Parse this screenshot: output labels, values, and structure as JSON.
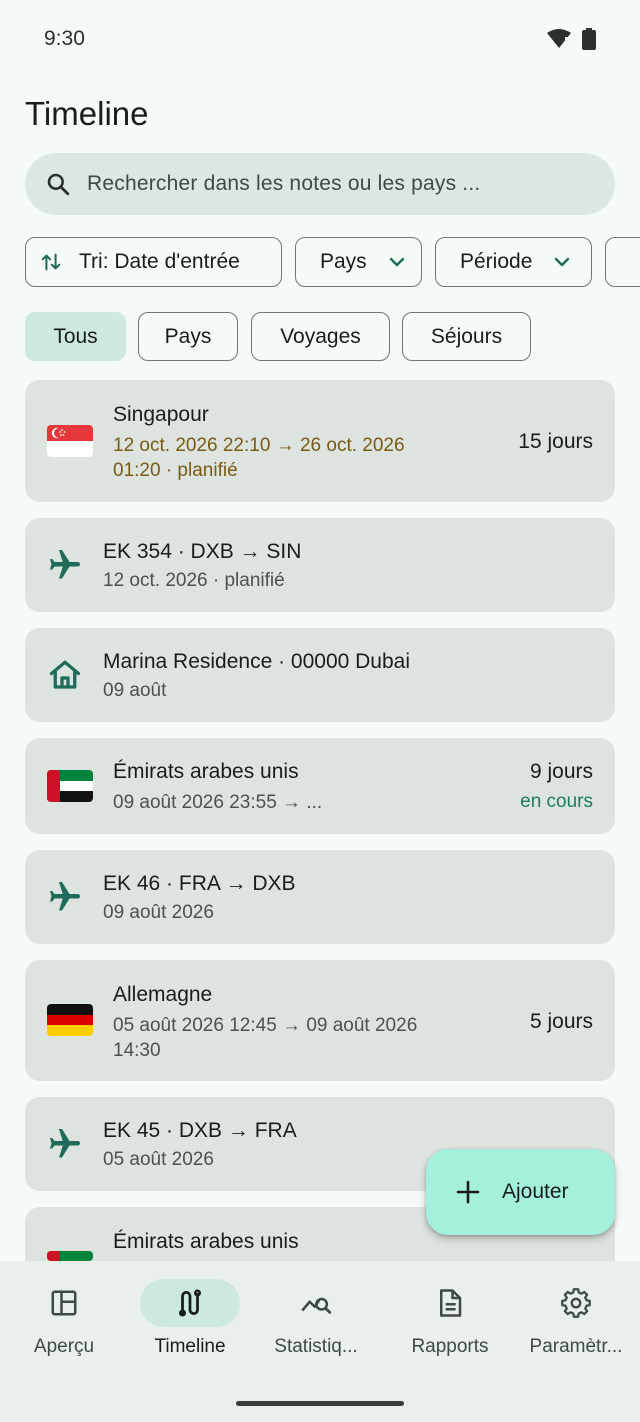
{
  "status": {
    "time": "9:30"
  },
  "page": {
    "title": "Timeline"
  },
  "search": {
    "placeholder": "Rechercher dans les notes ou les pays ..."
  },
  "filters": {
    "sort": "Tri: Date d'entrée",
    "country": "Pays",
    "period": "Période"
  },
  "segments": [
    "Tous",
    "Pays",
    "Voyages",
    "Séjours"
  ],
  "timeline": {
    "items": [
      {
        "kind": "country",
        "flag": "singapore",
        "title": "Singapour",
        "line1": "12 oct. 2026 22:10  →  26 oct. 2026",
        "line2": "01:20 · planifié",
        "days": "15 jours"
      },
      {
        "kind": "flight",
        "title": "EK 354 · DXB → SIN",
        "subtitle": "12 oct. 2026 · planifié"
      },
      {
        "kind": "stay",
        "title": "Marina Residence · 00000 Dubai",
        "subtitle": "09 août"
      },
      {
        "kind": "country",
        "flag": "uae",
        "title": "Émirats arabes unis",
        "line1": "09 août 2026 23:55  →  ...",
        "days": "9 jours",
        "status": "en cours"
      },
      {
        "kind": "flight",
        "title": "EK 46 · FRA → DXB",
        "subtitle": "09 août 2026"
      },
      {
        "kind": "country",
        "flag": "germany",
        "title": "Allemagne",
        "line1": "05 août 2026 12:45  →  09 août 2026",
        "line2": "14:30",
        "days": "5 jours"
      },
      {
        "kind": "flight",
        "title": "EK 45 · DXB → FRA",
        "subtitle": "05 août 2026"
      },
      {
        "kind": "country",
        "flag": "uae",
        "title": "Émirats arabes unis"
      }
    ]
  },
  "fab": {
    "label": "Ajouter"
  },
  "nav": {
    "items": [
      {
        "label": "Aperçu",
        "icon": "dashboard-icon"
      },
      {
        "label": "Timeline",
        "icon": "route-icon"
      },
      {
        "label": "Statistiq...",
        "icon": "analytics-icon"
      },
      {
        "label": "Rapports",
        "icon": "document-icon"
      },
      {
        "label": "Paramètr...",
        "icon": "gear-icon"
      }
    ]
  },
  "colors": {
    "accent": "#1f6b59",
    "planned": "#7a5a12",
    "ongoing": "#1f7a62",
    "fab": "#a4f0dc"
  }
}
